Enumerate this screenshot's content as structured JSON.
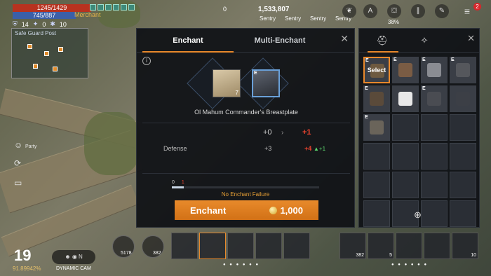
{
  "status": {
    "hp": "1245/1429",
    "mp": "745/887",
    "merchant": "Merchant",
    "stat_a": "14",
    "stat_b": "0",
    "stat_c": "10",
    "location": "Safe Guard Post"
  },
  "side": {
    "party": "Party"
  },
  "top": {
    "pearl_count": "0",
    "silver": "1,533,807",
    "sentry_labels": [
      "Sentry",
      "Sentry",
      "Sentry",
      "Sentry"
    ],
    "weight_pct": "38%",
    "notifications": "2"
  },
  "enchant": {
    "tabs": [
      {
        "label": "Enchant",
        "active": true
      },
      {
        "label": "Multi-Enchant",
        "active": false
      }
    ],
    "material_count": "7",
    "item_tag": "E",
    "item_name": "Ol Mahum Commander's Breastplate",
    "current_level": "+0",
    "next_level": "+1",
    "stat_name": "Defense",
    "stat_current": "+3",
    "stat_next": "+4",
    "stat_increase": "+1",
    "fail_count": "0",
    "fail_max": "1",
    "fail_progress": 0.08,
    "fail_text": "No Enchant Failure",
    "button_label": "Enchant",
    "cost": "1,000"
  },
  "inventory": {
    "select_label": "Select",
    "items": [
      {
        "tag": "E",
        "filled": true,
        "selected": true,
        "select": true,
        "color": "#6e5a40"
      },
      {
        "tag": "E",
        "filled": true,
        "selected": false,
        "select": false,
        "color": "#7a5c44"
      },
      {
        "tag": "E",
        "filled": true,
        "selected": false,
        "select": false,
        "color": "#8a8c92"
      },
      {
        "tag": "E",
        "filled": true,
        "selected": false,
        "select": false,
        "color": "#55575c"
      },
      {
        "tag": "E",
        "filled": true,
        "selected": false,
        "select": false,
        "color": "#5a4a3a"
      },
      {
        "tag": "",
        "filled": true,
        "selected": false,
        "select": false,
        "color": "#e8e8e8"
      },
      {
        "tag": "E",
        "filled": true,
        "selected": false,
        "select": false,
        "color": "#4a4c52"
      },
      {
        "tag": "",
        "filled": true,
        "selected": false,
        "select": false,
        "color": "#3c3f46"
      },
      {
        "tag": "E",
        "filled": true,
        "selected": false,
        "select": false,
        "color": "#6a645a"
      },
      {
        "tag": "",
        "filled": false,
        "selected": false,
        "select": false,
        "color": ""
      },
      {
        "tag": "",
        "filled": false,
        "selected": false,
        "select": false,
        "color": ""
      },
      {
        "tag": "",
        "filled": false,
        "selected": false,
        "select": false,
        "color": ""
      },
      {
        "tag": "",
        "filled": false,
        "selected": false,
        "select": false,
        "color": ""
      },
      {
        "tag": "",
        "filled": false,
        "selected": false,
        "select": false,
        "color": ""
      },
      {
        "tag": "",
        "filled": false,
        "selected": false,
        "select": false,
        "color": ""
      },
      {
        "tag": "",
        "filled": false,
        "selected": false,
        "select": false,
        "color": ""
      },
      {
        "tag": "",
        "filled": false,
        "selected": false,
        "select": false,
        "color": ""
      },
      {
        "tag": "",
        "filled": false,
        "selected": false,
        "select": false,
        "color": ""
      },
      {
        "tag": "",
        "filled": false,
        "selected": false,
        "select": false,
        "color": ""
      },
      {
        "tag": "",
        "filled": false,
        "selected": false,
        "select": false,
        "color": ""
      },
      {
        "tag": "",
        "filled": false,
        "selected": false,
        "select": false,
        "color": ""
      },
      {
        "tag": "",
        "filled": false,
        "selected": false,
        "select": false,
        "color": ""
      },
      {
        "tag": "",
        "filled": false,
        "selected": false,
        "select": false,
        "color": ""
      },
      {
        "tag": "",
        "filled": false,
        "selected": false,
        "select": false,
        "color": ""
      }
    ]
  },
  "hud": {
    "level": "19",
    "level_pct": "91.89942%",
    "cam_label": "DYNAMIC CAM",
    "hotbar_counts": [
      "5178",
      "382",
      "382",
      "5",
      "10"
    ]
  },
  "colors": {
    "accent": "#e8882b",
    "danger": "#f0442f",
    "positive": "#5cd86e",
    "hp": "#b8321f",
    "mp": "#3b5fa8"
  },
  "icons": [
    "info-icon",
    "close-icon",
    "helmet-icon",
    "crest-icon",
    "zoom-icon",
    "coin-icon",
    "menu-icon",
    "arrow-right-icon"
  ]
}
